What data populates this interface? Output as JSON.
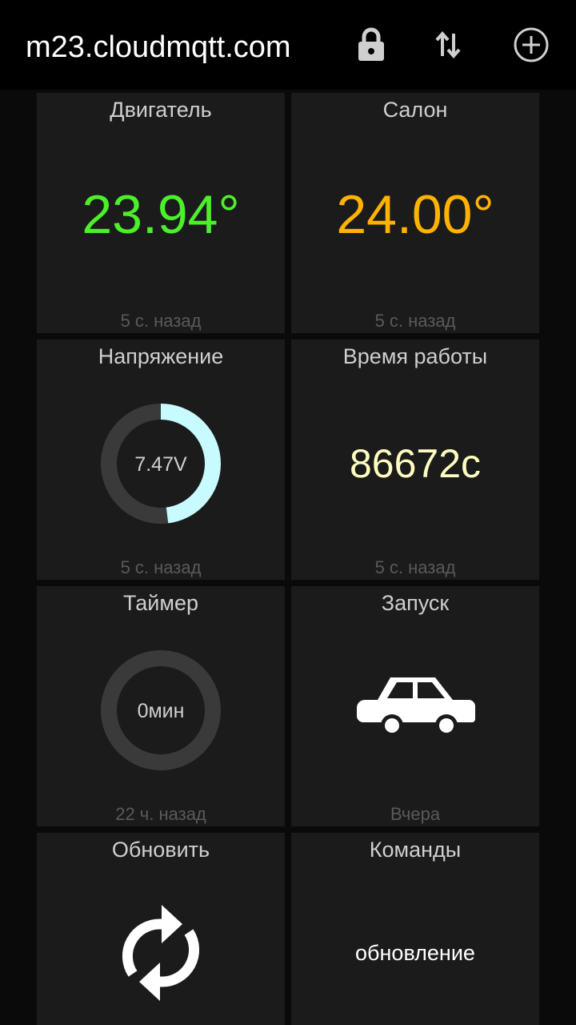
{
  "appbar": {
    "title": "m23.cloudmqtt.com",
    "icons": [
      "lock-icon",
      "swap-vertical-icon",
      "add-circle-icon"
    ]
  },
  "colors": {
    "engine_value": "#4cf02a",
    "cabin_value": "#ffb300",
    "uptime_value": "#fffcc0",
    "gauge_fill": "#c8fbff",
    "gauge_track": "#3a3a3a"
  },
  "tiles": {
    "engine": {
      "title": "Двигатель",
      "value": "23.94°",
      "footer": "5 с. назад"
    },
    "cabin": {
      "title": "Салон",
      "value": "24.00°",
      "footer": "5 с. назад"
    },
    "voltage": {
      "title": "Напряжение",
      "value": "7.47V",
      "level": 0.48,
      "footer": "5 с. назад"
    },
    "uptime": {
      "title": "Время работы",
      "value": "86672с",
      "footer": "5 с. назад"
    },
    "timer": {
      "title": "Таймер",
      "value": "0мин",
      "level": 0,
      "footer": "22 ч. назад"
    },
    "start": {
      "title": "Запуск",
      "icon": "car-icon",
      "footer": "Вчера"
    },
    "refresh": {
      "title": "Обновить",
      "icon": "refresh-icon"
    },
    "commands": {
      "title": "Команды",
      "value": "обновление"
    }
  }
}
